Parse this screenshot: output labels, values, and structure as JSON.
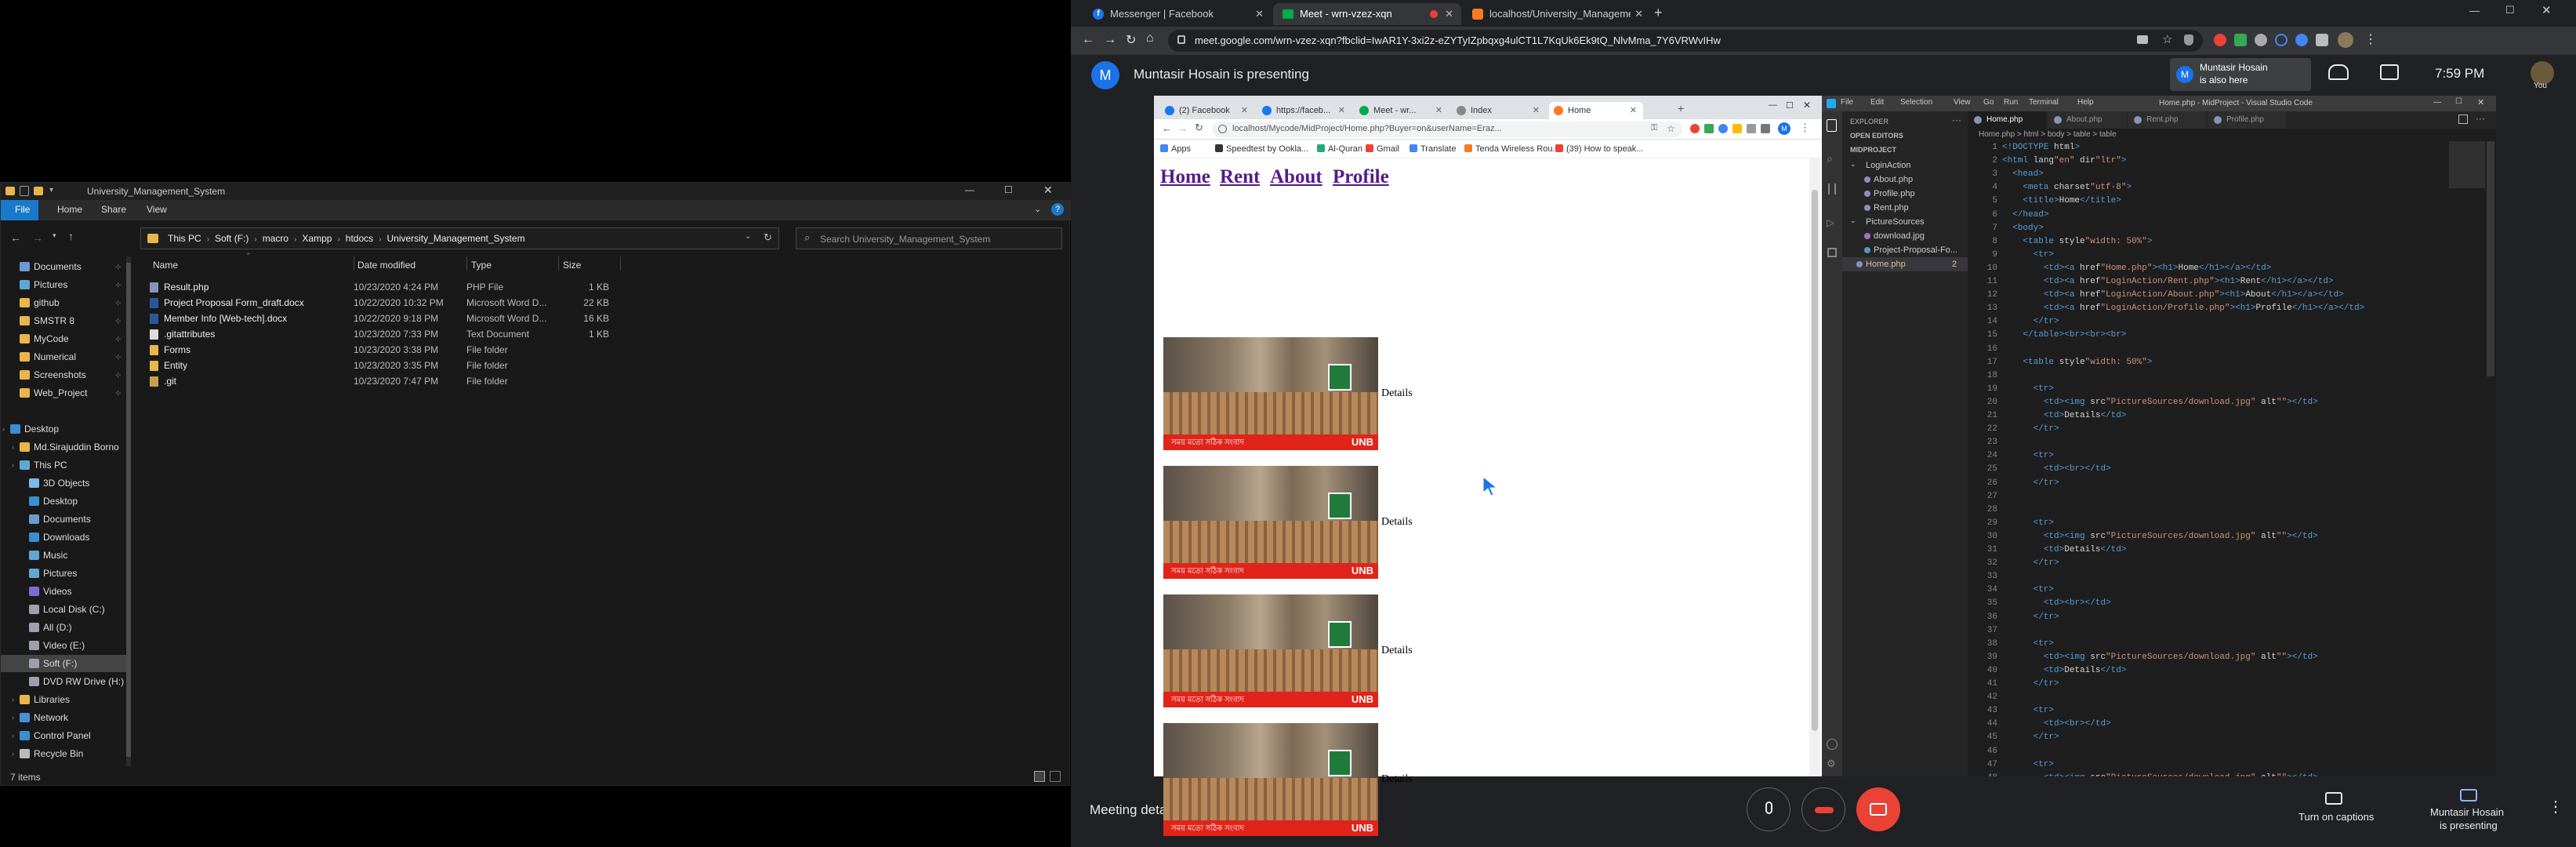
{
  "explorer": {
    "title": "University_Management_System",
    "ribbon_tabs": [
      "File",
      "Home",
      "Share",
      "View"
    ],
    "breadcrumb": [
      "This PC",
      "Soft (F:)",
      "macro",
      "Xampp",
      "htdocs",
      "University_Management_System"
    ],
    "search_placeholder": "Search University_Management_System",
    "columns": {
      "name": "Name",
      "date": "Date modified",
      "type": "Type",
      "size": "Size"
    },
    "files": [
      {
        "name": "Result.php",
        "date": "10/23/2020 4:24 PM",
        "type": "PHP File",
        "size": "1 KB",
        "icon": "php"
      },
      {
        "name": "Project Proposal Form_draft.docx",
        "date": "10/22/2020 10:32 PM",
        "type": "Microsoft Word D...",
        "size": "22 KB",
        "icon": "word"
      },
      {
        "name": "Member Info [Web-tech].docx",
        "date": "10/22/2020 9:18 PM",
        "type": "Microsoft Word D...",
        "size": "16 KB",
        "icon": "word"
      },
      {
        "name": ".gitattributes",
        "date": "10/23/2020 7:33 PM",
        "type": "Text Document",
        "size": "1 KB",
        "icon": "text"
      },
      {
        "name": "Forms",
        "date": "10/23/2020 3:38 PM",
        "type": "File folder",
        "size": "",
        "icon": "folder"
      },
      {
        "name": "Entity",
        "date": "10/23/2020 3:35 PM",
        "type": "File folder",
        "size": "",
        "icon": "folder"
      },
      {
        "name": ".git",
        "date": "10/23/2020 7:47 PM",
        "type": "File folder",
        "size": "",
        "icon": "folder-git"
      }
    ],
    "nav": [
      {
        "label": "Documents",
        "icon": "doc",
        "indent": 1
      },
      {
        "label": "Pictures",
        "icon": "pic",
        "indent": 1
      },
      {
        "label": "github",
        "icon": "folder",
        "indent": 1
      },
      {
        "label": "SMSTR 8",
        "icon": "folder",
        "indent": 1
      },
      {
        "label": "MyCode",
        "icon": "folder",
        "indent": 1
      },
      {
        "label": "Numerical",
        "icon": "folder",
        "indent": 1
      },
      {
        "label": "Screenshots",
        "icon": "folder",
        "indent": 1
      },
      {
        "label": "Web_Project",
        "icon": "folder",
        "indent": 1
      },
      {
        "label": "",
        "icon": "none",
        "indent": 0
      },
      {
        "label": "Desktop",
        "icon": "desk",
        "indent": 0
      },
      {
        "label": "Md.Sirajuddin Borno",
        "icon": "user",
        "indent": 1
      },
      {
        "label": "This PC",
        "icon": "pc",
        "indent": 1
      },
      {
        "label": "3D Objects",
        "icon": "3d",
        "indent": 2
      },
      {
        "label": "Desktop",
        "icon": "desk",
        "indent": 2
      },
      {
        "label": "Documents",
        "icon": "doc",
        "indent": 2
      },
      {
        "label": "Downloads",
        "icon": "dl",
        "indent": 2
      },
      {
        "label": "Music",
        "icon": "music",
        "indent": 2
      },
      {
        "label": "Pictures",
        "icon": "pic",
        "indent": 2
      },
      {
        "label": "Videos",
        "icon": "video",
        "indent": 2
      },
      {
        "label": "Local Disk (C:)",
        "icon": "drive",
        "indent": 2
      },
      {
        "label": "All (D:)",
        "icon": "drive",
        "indent": 2
      },
      {
        "label": "Video (E:)",
        "icon": "drive",
        "indent": 2
      },
      {
        "label": "Soft (F:)",
        "icon": "drive",
        "indent": 2
      },
      {
        "label": "DVD RW Drive (H:)",
        "icon": "dvd",
        "indent": 2
      },
      {
        "label": "Libraries",
        "icon": "lib",
        "indent": 1
      },
      {
        "label": "Network",
        "icon": "net",
        "indent": 1
      },
      {
        "label": "Control Panel",
        "icon": "cp",
        "indent": 1
      },
      {
        "label": "Recycle Bin",
        "icon": "bin",
        "indent": 1
      }
    ],
    "status": "7 items"
  },
  "chrome": {
    "tabs": [
      {
        "title": "Messenger | Facebook",
        "icon": "facebook-icon"
      },
      {
        "title": "Meet - wrn-vzez-xqn",
        "icon": "meet-icon"
      },
      {
        "title": "localhost/University_Manageme...",
        "icon": "xampp-icon"
      }
    ],
    "url": "meet.google.com/wrn-vzez-xqn?fbclid=IwAR1Y-3xi2z-eZYTyIZpbqxg4ulCT1L7KqUk6Ek9tQ_NlvMma_7Y6VRWvIHw"
  },
  "meet": {
    "presenting_banner": "Muntasir Hosain is presenting",
    "presenter_initial": "M",
    "also_here_name": "Muntasir Hosain",
    "also_here_text": "is also here",
    "time": "7:59 PM",
    "you_label": "You",
    "meeting_details": "Meeting details",
    "captions_label": "Turn on captions",
    "presenting_label_1": "Muntasir Hosain",
    "presenting_label_2": "is presenting"
  },
  "inner_browser": {
    "tabs": [
      "(2) Facebook",
      "https://faceb...",
      "Meet - wr...",
      "Index",
      "Home"
    ],
    "url": "localhost/Mycode/MidProject/Home.php?Buyer=on&userName=Eraz...",
    "bookmarks": [
      "Apps",
      "Speedtest by Ookla...",
      "Al-Quran",
      "Gmail",
      "Translate",
      "Tenda Wireless Rou...",
      "(39) How to speak..."
    ],
    "nav_links": [
      "Home",
      "Rent",
      "About",
      "Profile"
    ],
    "rows": [
      {
        "text": "Details",
        "sign": "UNB",
        "caption": "সময় মতো সঠিক সংবাদ"
      },
      {
        "text": "Details",
        "sign": "UNB",
        "caption": "সময় মতো সঠিক সংবাদ"
      },
      {
        "text": "Details",
        "sign": "UNB",
        "caption": "সময় মতো সঠিক সংবাদ"
      },
      {
        "text": "Details",
        "sign": "UNB",
        "caption": "সময় মতো সঠিক সংবাদ"
      }
    ]
  },
  "vscode": {
    "title": "Home.php - MidProject - Visual Studio Code",
    "menus": [
      "File",
      "Edit",
      "Selection",
      "View",
      "Go",
      "Run",
      "Terminal",
      "Help"
    ],
    "tabs": [
      "Home.php",
      "About.php",
      "Rent.php",
      "Profile.php"
    ],
    "breadcrumb": "Home.php > html > body > table > table",
    "explorer_header": "EXPLORER",
    "open_editors": "OPEN EDITORS",
    "project": "MIDPROJECT",
    "tree": [
      {
        "label": "LoginAction",
        "depth": 1,
        "folder": true
      },
      {
        "label": "About.php",
        "depth": 2,
        "folder": false
      },
      {
        "label": "Profile.php",
        "depth": 2,
        "folder": false
      },
      {
        "label": "Rent.php",
        "depth": 2,
        "folder": false
      },
      {
        "label": "PictureSources",
        "depth": 1,
        "folder": true
      },
      {
        "label": "download.jpg",
        "depth": 2,
        "folder": false
      },
      {
        "label": "Project-Proposal-Fo...",
        "depth": 2,
        "folder": false
      },
      {
        "label": "Home.php",
        "depth": 1,
        "folder": false
      }
    ],
    "tree_badge": "2",
    "lines": [
      "<!DOCTYPE html>",
      "<html lang=\"en\" dir=\"ltr\">",
      "  <head>",
      "    <meta charset=\"utf-8\">",
      "    <title>Home</title>",
      "  </head>",
      "  <body>",
      "    <table style=\"width: 50%\">",
      "      <tr>",
      "        <td><a href=\"Home.php\"><h1>Home</h1></a></td>",
      "        <td><a href=\"LoginAction/Rent.php\"><h1>Rent</h1></a></td>",
      "        <td><a href=\"LoginAction/About.php\"><h1>About</h1></a></td>",
      "        <td><a href=\"LoginAction/Profile.php\"><h1>Profile</h1></a></td>",
      "      </tr>",
      "    </table><br><br><br>",
      "",
      "    <table style=\"width: 50%\">",
      "",
      "      <tr>",
      "        <td><img src=\"PictureSources/download.jpg\" alt=\"\"></td>",
      "        <td>Details</td>",
      "      </tr>",
      "",
      "      <tr>",
      "        <td><br></td>",
      "      </tr>",
      "",
      "",
      "      <tr>",
      "        <td><img src=\"PictureSources/download.jpg\" alt=\"\"></td>",
      "        <td>Details</td>",
      "      </tr>",
      "",
      "      <tr>",
      "        <td><br></td>",
      "      </tr>",
      "",
      "      <tr>",
      "        <td><img src=\"PictureSources/download.jpg\" alt=\"\"></td>",
      "        <td>Details</td>",
      "      </tr>",
      "",
      "      <tr>",
      "        <td><br></td>",
      "      </tr>",
      "",
      "      <tr>",
      "        <td><img src=\"PictureSources/download.jpg\" alt=\"\"></td>"
    ]
  },
  "colors": {
    "meet_bg": "#202124",
    "leave_red": "#ea4335",
    "accent_blue": "#1a73e8",
    "explorer_bg": "#191919"
  }
}
